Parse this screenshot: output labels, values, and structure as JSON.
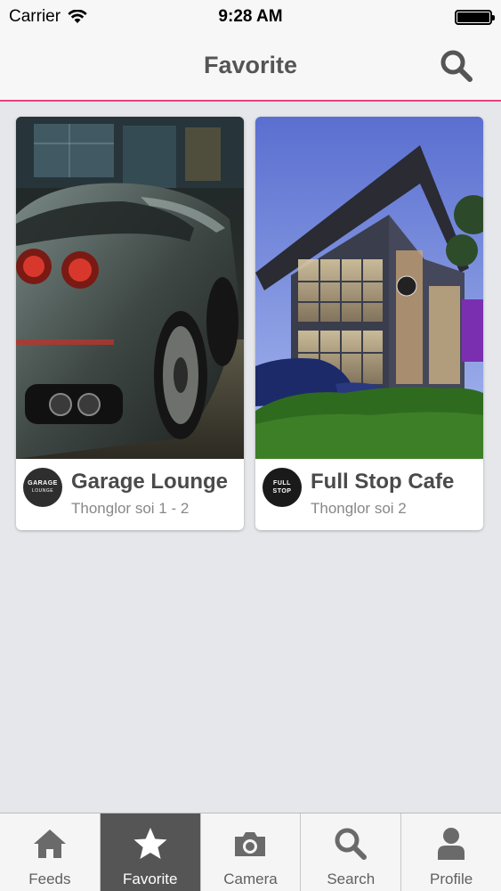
{
  "status_bar": {
    "carrier": "Carrier",
    "time": "9:28 AM"
  },
  "nav": {
    "title": "Favorite",
    "search_icon": "search-icon",
    "accent_color": "#e8407f"
  },
  "cards": [
    {
      "name": "Garage Lounge",
      "location": "Thonglor soi 1 - 2",
      "logo_line1": "GARAGE",
      "logo_line2": "LOUNGE",
      "photo": "sports-car-photo"
    },
    {
      "name": "Full Stop Cafe",
      "location": "Thonglor soi 2",
      "logo_line1": "FULL",
      "logo_line2": "STOP",
      "photo": "cafe-building-photo"
    }
  ],
  "tabs": [
    {
      "label": "Feeds",
      "icon": "home-icon",
      "active": false
    },
    {
      "label": "Favorite",
      "icon": "star-icon",
      "active": true
    },
    {
      "label": "Camera",
      "icon": "camera-icon",
      "active": false
    },
    {
      "label": "Search",
      "icon": "search-icon",
      "active": false
    },
    {
      "label": "Profile",
      "icon": "person-icon",
      "active": false
    }
  ]
}
